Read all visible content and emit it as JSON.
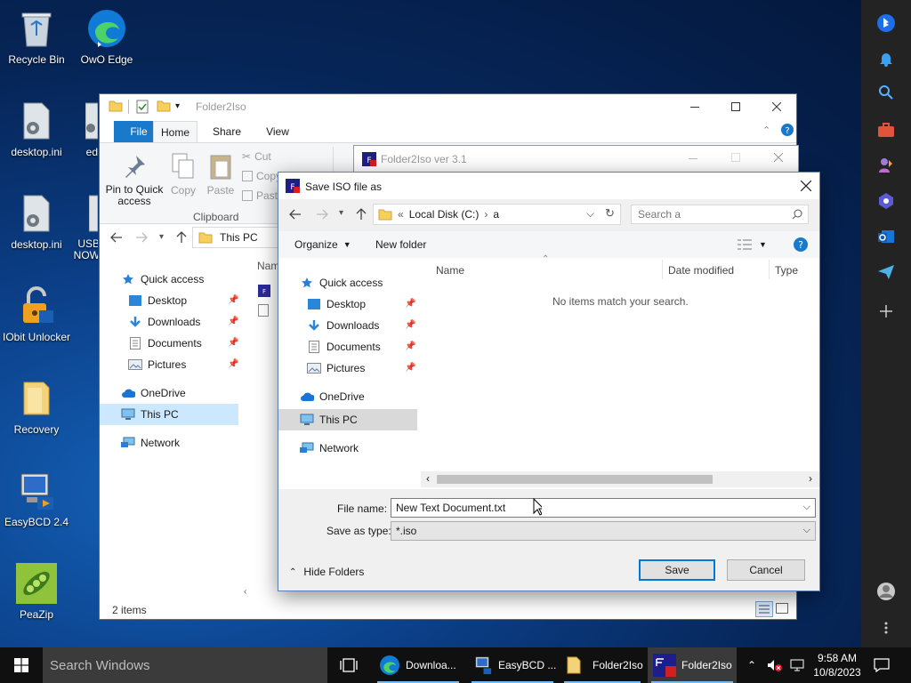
{
  "desktop": {
    "icons": [
      {
        "label": "Recycle Bin"
      },
      {
        "label": "OwO Edge"
      },
      {
        "label": "desktop.ini"
      },
      {
        "label": "ed"
      },
      {
        "label": "desktop.ini"
      },
      {
        "label": "USB NOW"
      },
      {
        "label": "IObit Unlocker"
      },
      {
        "label": "Recovery"
      },
      {
        "label": "EasyBCD 2.4"
      },
      {
        "label": "PeaZip"
      }
    ]
  },
  "explorer": {
    "title": "Folder2Iso",
    "tabs": [
      "File",
      "Home",
      "Share",
      "View"
    ],
    "ribbon": {
      "pin_label": "Pin to Quick access",
      "copy_label": "Copy",
      "paste_label": "Paste",
      "cut_label": "Cut",
      "copy_path_label": "Copy",
      "paste_shortcut_label": "Past",
      "group_label": "Clipboard"
    },
    "address": "This PC",
    "column_name": "Nam",
    "nav": [
      "Quick access",
      "Desktop",
      "Downloads",
      "Documents",
      "Pictures",
      "OneDrive",
      "This PC",
      "Network"
    ],
    "status": "2 items"
  },
  "folder2iso": {
    "title": "Folder2Iso ver 3.1"
  },
  "dialog": {
    "title": "Save ISO file as",
    "path": {
      "prefix": "«",
      "disk": "Local Disk (C:)",
      "sep": "›",
      "folder": "a"
    },
    "search_placeholder": "Search a",
    "organize_label": "Organize",
    "new_folder_label": "New folder",
    "columns": {
      "name": "Name",
      "date": "Date modified",
      "type": "Type"
    },
    "empty_message": "No items match your search.",
    "nav": [
      "Quick access",
      "Desktop",
      "Downloads",
      "Documents",
      "Pictures",
      "OneDrive",
      "This PC",
      "Network"
    ],
    "file_name_label": "File name:",
    "file_name_value": "New Text Document.txt",
    "save_type_label": "Save as type:",
    "save_type_value": "*.iso",
    "hide_folders_label": "Hide Folders",
    "save_label": "Save",
    "cancel_label": "Cancel"
  },
  "taskbar": {
    "search_placeholder": "Search Windows",
    "apps": [
      {
        "label": "Downloa..."
      },
      {
        "label": "EasyBCD ..."
      },
      {
        "label": "Folder2Iso"
      },
      {
        "label": "Folder2Iso"
      }
    ],
    "time": "9:58 AM",
    "date": "10/8/2023"
  },
  "colors": {
    "accent": "#0078d7",
    "file_tab": "#1979ca",
    "selected": "#cce8ff"
  }
}
